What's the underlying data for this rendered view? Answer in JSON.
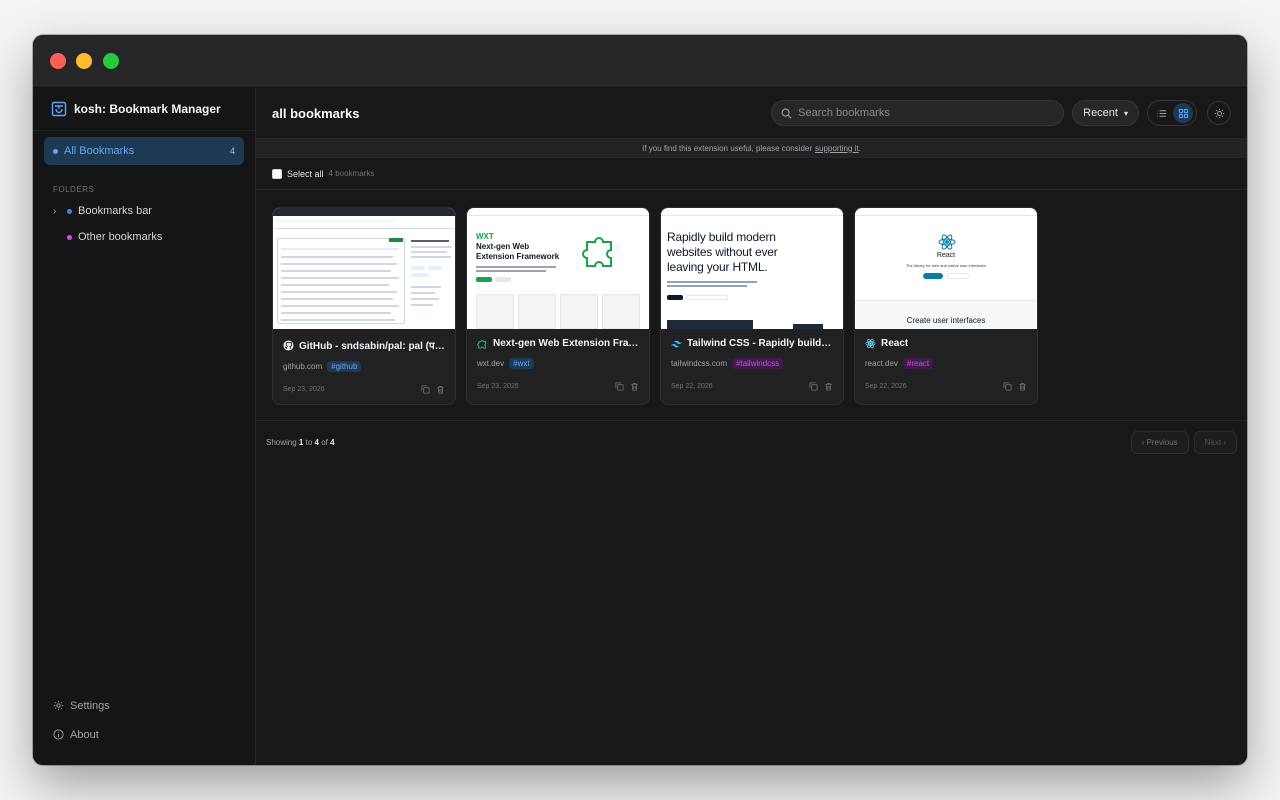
{
  "sidebar": {
    "app_name": "kosh: Bookmark Manager",
    "nav_all": {
      "label": "All Bookmarks",
      "count": "4"
    },
    "folders_heading": "FOLDERS",
    "folders": [
      {
        "label": "Bookmarks bar",
        "color": "#3b82f6",
        "expandable": true
      },
      {
        "label": "Other bookmarks",
        "color": "#d946ef",
        "expandable": false
      }
    ],
    "settings_label": "Settings",
    "about_label": "About"
  },
  "header": {
    "title": "all bookmarks",
    "search_placeholder": "Search bookmarks",
    "sort_value": "Recent",
    "view_mode": "grid"
  },
  "banner": {
    "text": "If you find this extension useful, please consider",
    "link": "supporting it",
    "end": "."
  },
  "select": {
    "label": "Select all",
    "count": "4 bookmarks"
  },
  "bookmarks": [
    {
      "title": "GitHub - sndsabin/pal: pal (पल), N...",
      "domain": "github.com",
      "tag": "#github",
      "tag_color": "blue",
      "date": "Sep 23, 2026",
      "icon": "github-icon"
    },
    {
      "title": "Next-gen Web Extension Framew...",
      "domain": "wxt.dev",
      "tag": "#wxt",
      "tag_color": "blue",
      "date": "Sep 23, 2026",
      "icon": "wxt-icon"
    },
    {
      "title": "Tailwind CSS - Rapidly build mod...",
      "domain": "tailwindcss.com",
      "tag": "#tailwindcss",
      "tag_color": "purple",
      "date": "Sep 22, 2026",
      "icon": "tailwind-icon"
    },
    {
      "title": "React",
      "domain": "react.dev",
      "tag": "#react",
      "tag_color": "purple",
      "date": "Sep 22, 2026",
      "icon": "react-icon"
    }
  ],
  "thumbs": {
    "wxt_line1": "WXT",
    "wxt_line2": "Next-gen Web",
    "wxt_line3": "Extension Framework",
    "tw_line1": "Rapidly build modern",
    "tw_line2": "websites without ever",
    "tw_line3": "leaving your HTML.",
    "react_name": "React",
    "react_sub": "The library for web and native user interfaces",
    "react_cui": "Create user interfaces"
  },
  "pager": {
    "prefix": "Showing",
    "from": "1",
    "to_word": "to",
    "to": "4",
    "of_word": "of",
    "total": "4",
    "prev_label": "‹ Previous",
    "next_label": "Next ›"
  }
}
